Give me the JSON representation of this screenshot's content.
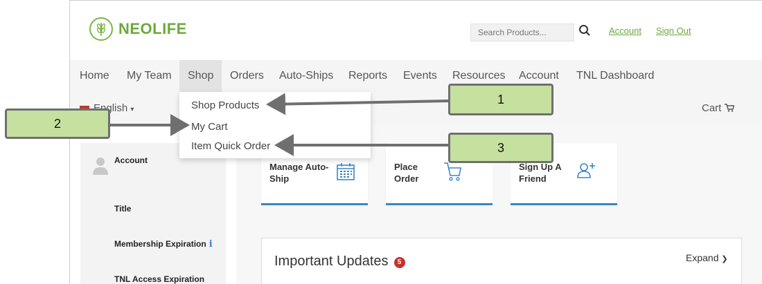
{
  "header": {
    "logo_text": "NEOLIFE",
    "search_placeholder": "Search Products...",
    "account_link": "Account",
    "signout_link": "Sign Out"
  },
  "nav": {
    "items": [
      {
        "label": "Home"
      },
      {
        "label": "My Team"
      },
      {
        "label": "Shop"
      },
      {
        "label": "Orders"
      },
      {
        "label": "Auto-Ships"
      },
      {
        "label": "Reports"
      },
      {
        "label": "Events"
      },
      {
        "label": "Resources"
      },
      {
        "label": "Account"
      },
      {
        "label": "TNL Dashboard"
      }
    ],
    "active": "Shop"
  },
  "subbar": {
    "language": "English",
    "cart": "Cart"
  },
  "dropdown": {
    "items": [
      {
        "label": "Shop Products"
      },
      {
        "label": "My Cart"
      },
      {
        "label": "Item Quick Order"
      }
    ]
  },
  "left_panel": {
    "account": "Account",
    "title": "Title",
    "membership": "Membership Expiration",
    "info_icon": "i",
    "tnl_access": "TNL Access Expiration"
  },
  "tiles": [
    {
      "line1": "Manage Auto-",
      "line2": "Ship",
      "icon": "calendar-icon"
    },
    {
      "line1": "Place",
      "line2": "Order",
      "icon": "cart-icon"
    },
    {
      "line1": "Sign Up A",
      "line2": "Friend",
      "icon": "add-user-icon"
    }
  ],
  "updates": {
    "title": "Important Updates",
    "count": "5",
    "expand": "Expand"
  },
  "callouts": [
    {
      "label": "1"
    },
    {
      "label": "2"
    },
    {
      "label": "3"
    }
  ],
  "colors": {
    "brand_green": "#6aaa3a",
    "tile_accent": "#3a86c8",
    "callout_fill": "#c6e0a0",
    "badge_red": "#c9302c"
  }
}
